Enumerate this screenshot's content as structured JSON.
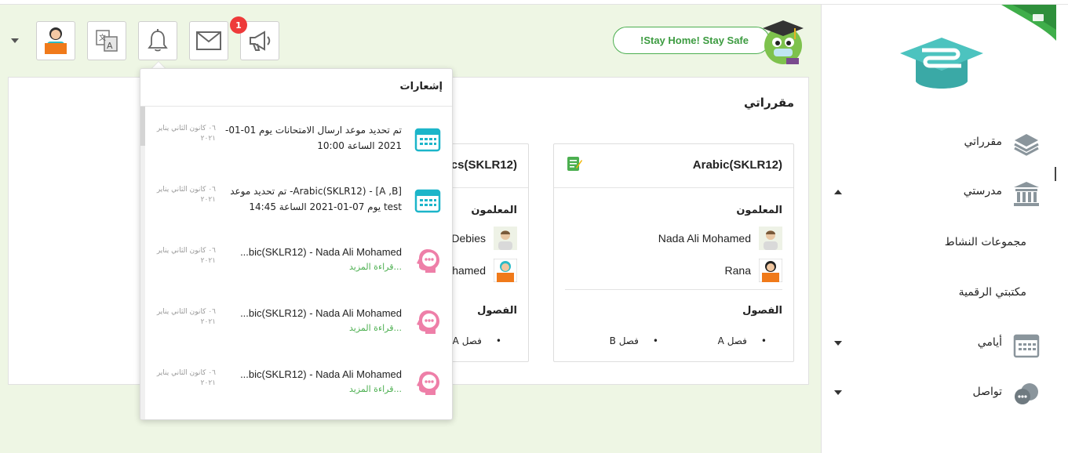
{
  "header": {
    "stay_home": "!Stay Home! Stay Safe",
    "badge_count": "1"
  },
  "sidebar": {
    "items": [
      {
        "label": "مقرراتي",
        "icon": "layers-icon"
      },
      {
        "label": "مدرستي",
        "icon": "school-building-icon"
      },
      {
        "label": "أيامي",
        "icon": "calendar-icon"
      },
      {
        "label": "تواصل",
        "icon": "chat-bubbles-icon"
      }
    ],
    "sub_items": [
      "مجموعات النشاط",
      "مكتبتي الرقمية"
    ]
  },
  "main": {
    "title": "مقرراتي",
    "courses": [
      {
        "title": "Arabic(SKLR12)",
        "teachers_label": "المعلمون",
        "teachers": [
          "Nada Ali Mohamed",
          "Rana"
        ],
        "classes_label": "الفصول",
        "classes": [
          "فصل A",
          "فصل B"
        ]
      },
      {
        "title": "cs(SKLR12)",
        "teachers_label": "المعلمون",
        "teachers": [
          "Debies",
          "hamed"
        ],
        "classes_label": "الفصول",
        "classes": [
          "فصل A"
        ]
      }
    ]
  },
  "notifications": {
    "title": "إشعارات",
    "items": [
      {
        "line1": "تم تحديد موعد ارسال الامتحانات يوم 01-01-",
        "line2": "2021 الساعة 10:00",
        "date": "٠٦ كانون الثاني يناير ٢٠٢١",
        "icon": "calendar-icon"
      },
      {
        "line1": "Arabic(SKLR12) - [A ,B]- تم تحديد موعد",
        "line2": "test يوم 07-01-2021 الساعة 14:45",
        "date": "٠٦ كانون الثاني يناير ٢٠٢١",
        "icon": "calendar-icon"
      },
      {
        "line1": "...bic(SKLR12) - Nada Ali Mohamed",
        "more": "...قراءة المزيد",
        "date": "٠٦ كانون الثاني يناير ٢٠٢١",
        "icon": "thinking-head-icon"
      },
      {
        "line1": "...bic(SKLR12) - Nada Ali Mohamed",
        "more": "...قراءة المزيد",
        "date": "٠٦ كانون الثاني يناير ٢٠٢١",
        "icon": "thinking-head-icon"
      },
      {
        "line1": "...bic(SKLR12) - Nada Ali Mohamed",
        "more": "...قراءة المزيد",
        "date": "٠٦ كانون الثاني يناير ٢٠٢١",
        "icon": "thinking-head-icon"
      }
    ]
  },
  "colors": {
    "background": "#eef6e4",
    "accent_green": "#4caf50",
    "teal_logo": "#4cc3bf",
    "badge_red": "#ee3a3a",
    "calendar_teal": "#1cb5c9",
    "pink_icon": "#ee7fa8"
  }
}
